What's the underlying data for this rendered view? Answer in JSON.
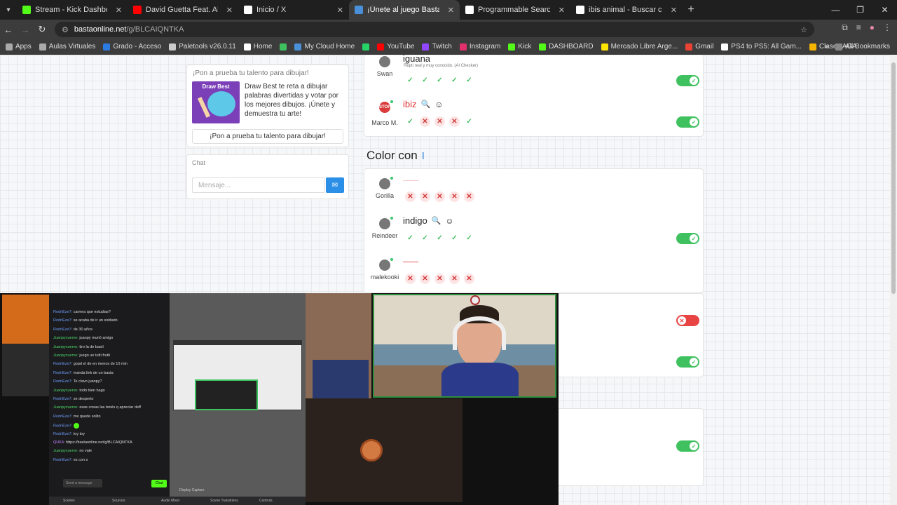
{
  "browser": {
    "tabs": [
      {
        "label": "Stream - Kick Dashboard",
        "color": "#53fc18"
      },
      {
        "label": "David Guetta Feat. Akon - S",
        "color": "#ff0000"
      },
      {
        "label": "Inicio / X",
        "color": "#ffffff"
      },
      {
        "label": "¡Únete al juego Basta!",
        "color": "#4a90d9",
        "active": true
      },
      {
        "label": "Programmable Search Engine",
        "color": "#ffffff"
      },
      {
        "label": "ibis animal - Buscar con Google",
        "color": "#ffffff"
      }
    ],
    "url_domain": "bastaonline.net",
    "url_path": "/g/BLCAIQNTKA",
    "bookmarks": [
      {
        "label": "Apps",
        "color": "#aaaaaa"
      },
      {
        "label": "Aulas Virtuales",
        "color": "#aaaaaa"
      },
      {
        "label": "Grado - Acceso",
        "color": "#2b7be0"
      },
      {
        "label": "Paletools v26.0.11",
        "color": "#cccccc"
      },
      {
        "label": "Home",
        "color": "#ffffff"
      },
      {
        "label": "",
        "color": "#3ec15e"
      },
      {
        "label": "My Cloud Home",
        "color": "#4a90d9"
      },
      {
        "label": "",
        "color": "#25d366"
      },
      {
        "label": "YouTube",
        "color": "#ff0000"
      },
      {
        "label": "Twitch",
        "color": "#9146ff"
      },
      {
        "label": "Instagram",
        "color": "#e1306c"
      },
      {
        "label": "Kick",
        "color": "#53fc18"
      },
      {
        "label": "DASHBOARD",
        "color": "#53fc18"
      },
      {
        "label": "Mercado Libre Arge...",
        "color": "#ffe600"
      },
      {
        "label": "Gmail",
        "color": "#ea4335"
      },
      {
        "label": "PS4 to PS5: All Gam...",
        "color": "#ffffff"
      },
      {
        "label": "Clases AGA",
        "color": "#f5b400"
      }
    ],
    "all_bookmarks": "All Bookmarks"
  },
  "promo": {
    "title": "¡Pon a prueba tu talento para dibujar!",
    "image_title": "Draw Best",
    "text": "Draw Best te reta a dibujar palabras divertidas y votar por los mejores dibujos. ¡Únete y demuestra tu arte!",
    "button": "¡Pon a prueba tu talento para dibujar!"
  },
  "chat": {
    "title": "Chat",
    "placeholder": "Mensaje..."
  },
  "game": {
    "prev_category": {
      "rows": [
        {
          "player": "Swan",
          "answer": "iguana",
          "sub": "Repti real y muy conocido. (AI Checker)",
          "marks": [
            "ok",
            "ok",
            "ok",
            "ok",
            "ok"
          ],
          "toggle": "on"
        },
        {
          "player": "Marco M.",
          "answer": "ibiz",
          "marks": [
            "ok",
            "no",
            "no",
            "no",
            "ok"
          ],
          "toggle": "on"
        }
      ]
    },
    "category_title": "Color con",
    "category_letter": "I",
    "rows": [
      {
        "player": "Gorilla",
        "answer": "",
        "marks": [
          "no",
          "no",
          "no",
          "no",
          "no"
        ]
      },
      {
        "player": "Reindeer",
        "answer": "indigo",
        "marks": [
          "ok",
          "ok",
          "ok",
          "ok",
          "ok"
        ],
        "toggle": "on"
      },
      {
        "player": "malekooki",
        "answer": "",
        "marks": [
          "no",
          "no",
          "no",
          "no",
          "no"
        ]
      }
    ],
    "hidden_toggles": [
      "off",
      "on",
      "on"
    ]
  },
  "overlay": {
    "chat_lines": [
      {
        "user": "RodriEze7:",
        "msg": "carrera que estudias?",
        "cls": "u1"
      },
      {
        "user": "RodriEze7:",
        "msg": "se acaba de ir un soldado",
        "cls": "u1"
      },
      {
        "user": "RodriEze7:",
        "msg": "de 30 años",
        "cls": "u1"
      },
      {
        "user": "Juanpycuervo:",
        "msg": "juanpy murió amigo",
        "cls": "u2"
      },
      {
        "user": "Juanpycuervo:",
        "msg": "tiro la de bastí",
        "cls": "u2"
      },
      {
        "user": "Juanpycuervo:",
        "msg": "juego un tutti frutti",
        "cls": "u2"
      },
      {
        "user": "RodriEze7:",
        "msg": "gopd el de en menos de 10 min",
        "cls": "u1"
      },
      {
        "user": "RodriEze7:",
        "msg": "manda link de un basta",
        "cls": "u1"
      },
      {
        "user": "RodriEze7:",
        "msg": "Te clavo juanpy?",
        "cls": "u1"
      },
      {
        "user": "Juanpycuervo:",
        "msg": "todo bien hago",
        "cls": "u2"
      },
      {
        "user": "RodriEze7:",
        "msg": "se desperto",
        "cls": "u1"
      },
      {
        "user": "Juanpycuervo:",
        "msg": "esas cosas las tenés q apreciar deff",
        "cls": "u2"
      },
      {
        "user": "RodriEze7:",
        "msg": "me quede solito",
        "cls": "u1"
      },
      {
        "user": "RodriEze7:",
        "msg": "",
        "cls": "u1"
      },
      {
        "user": "RodriEze7:",
        "msg": "toy toy",
        "cls": "u1"
      },
      {
        "user": "QUK4:",
        "msg": "https://bastaonline.net/g/BLCAIQNTKA",
        "cls": "u3"
      },
      {
        "user": "Juanpycuervo:",
        "msg": "no vale",
        "cls": "u2"
      },
      {
        "user": "RodriEze7:",
        "msg": "es con s",
        "cls": "u1"
      }
    ],
    "send_placeholder": "Send a message",
    "chat_button": "Chat",
    "obs_labels": [
      "Scenes",
      "Sources",
      "Audio Mixer",
      "Scene Transitions",
      "Controls"
    ],
    "display_capture": "Display Capture"
  }
}
